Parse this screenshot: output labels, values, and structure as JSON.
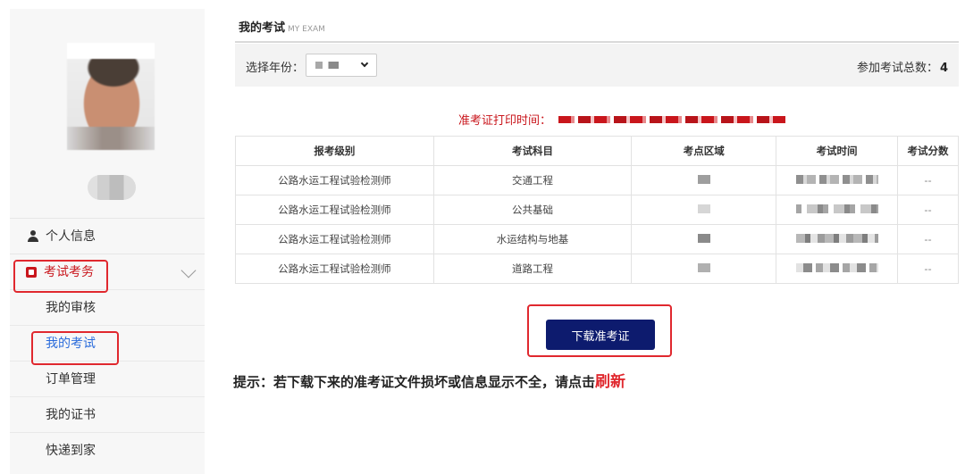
{
  "sidebar": {
    "menu": {
      "personal_info": "个人信息",
      "exam_affairs": "考试考务",
      "sub_items": [
        "我的审核",
        "我的考试",
        "订单管理",
        "我的证书",
        "快递到家"
      ]
    },
    "active_item": "我的考试"
  },
  "header": {
    "title": "我的考试",
    "title_en": "MY EXAM"
  },
  "filter": {
    "year_label": "选择年份：",
    "total_label": "参加考试总数：",
    "total_value": "4"
  },
  "print_time_label": "准考证打印时间：",
  "table": {
    "headers": [
      "报考级别",
      "考试科目",
      "考点区域",
      "考试时间",
      "考试分数"
    ],
    "rows": [
      {
        "level": "公路水运工程试验检测师",
        "subject": "交通工程",
        "score": "--"
      },
      {
        "level": "公路水运工程试验检测师",
        "subject": "公共基础",
        "score": "--"
      },
      {
        "level": "公路水运工程试验检测师",
        "subject": "水运结构与地基",
        "score": "--"
      },
      {
        "level": "公路水运工程试验检测师",
        "subject": "道路工程",
        "score": "--"
      }
    ]
  },
  "download_button": "下载准考证",
  "tip": {
    "text": "提示：若下载下来的准考证文件损坏或信息显示不全，请点击",
    "link": "刷新"
  },
  "colors": {
    "accent_red": "#c9161c",
    "highlight_red": "#e0282e",
    "button_navy": "#0d1b6e",
    "active_blue": "#2b6cdb"
  }
}
